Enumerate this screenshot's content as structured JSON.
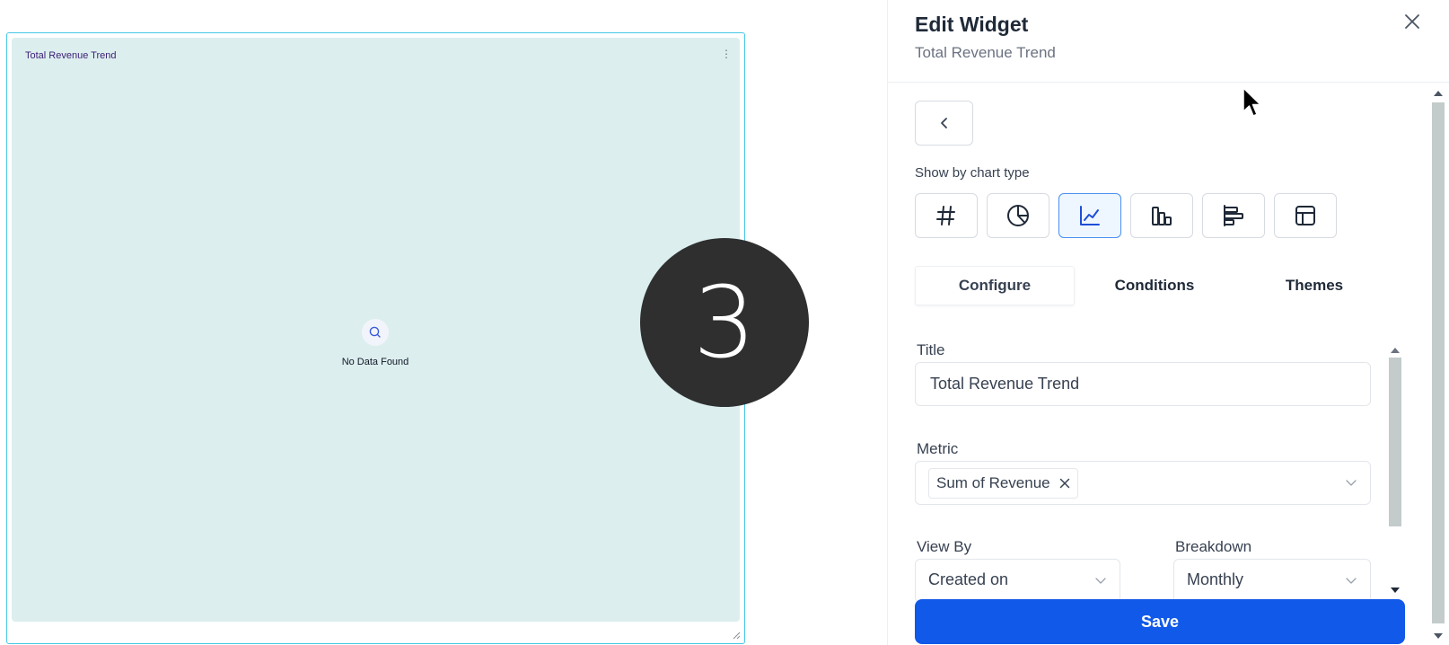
{
  "widget": {
    "title": "Total Revenue Trend",
    "menu_glyph": "⋮",
    "empty_text": "No Data Found",
    "frame_color": "#45c8e6",
    "card_bg": "#dceeee"
  },
  "step_marker": {
    "label": "3"
  },
  "panel": {
    "title": "Edit Widget",
    "subtitle": "Total Revenue Trend",
    "chart_type_label": "Show by chart type",
    "chart_types": [
      {
        "icon": "hash-icon",
        "active": false
      },
      {
        "icon": "pie-chart-icon",
        "active": false
      },
      {
        "icon": "line-chart-icon",
        "active": true
      },
      {
        "icon": "bar-chart-icon",
        "active": false
      },
      {
        "icon": "horizontal-bar-chart-icon",
        "active": false
      },
      {
        "icon": "table-icon",
        "active": false
      }
    ],
    "tabs": [
      {
        "label": "Configure",
        "active": true
      },
      {
        "label": "Conditions",
        "active": false
      },
      {
        "label": "Themes",
        "active": false
      }
    ],
    "form": {
      "title_label": "Title",
      "title_value": "Total Revenue Trend",
      "metric_label": "Metric",
      "metric_chip": "Sum of Revenue",
      "view_by_label": "View By",
      "view_by_value": "Created on",
      "breakdown_label": "Breakdown",
      "breakdown_value": "Monthly"
    },
    "save_label": "Save",
    "accent_color": "#1159e8"
  }
}
